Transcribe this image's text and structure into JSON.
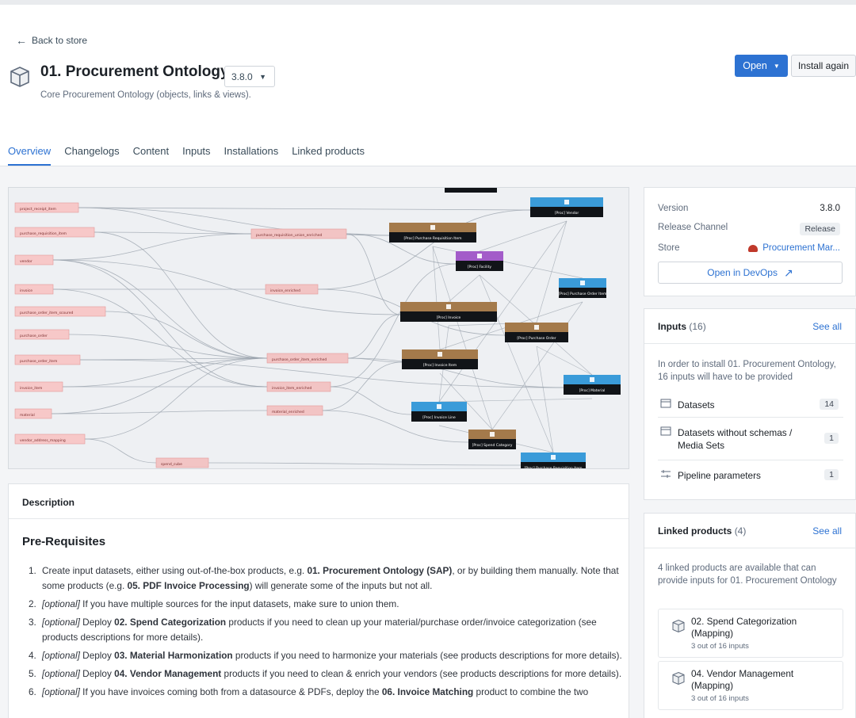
{
  "nav": {
    "back_label": "Back to store"
  },
  "product": {
    "title": "01. Procurement Ontology",
    "version": "3.8.0",
    "subtitle": "Core Procurement Ontology (objects, links & views)."
  },
  "actions": {
    "open_label": "Open",
    "install_label": "Install again"
  },
  "tabs": [
    {
      "label": "Overview",
      "active": true
    },
    {
      "label": "Changelogs"
    },
    {
      "label": "Content"
    },
    {
      "label": "Inputs"
    },
    {
      "label": "Installations"
    },
    {
      "label": "Linked products"
    }
  ],
  "sidebar": {
    "meta": {
      "version_label": "Version",
      "version_value": "3.8.0",
      "channel_label": "Release Channel",
      "channel_value": "Release",
      "store_label": "Store",
      "store_value": "Procurement Mar...",
      "devops_label": "Open in DevOps"
    },
    "inputs": {
      "title": "Inputs",
      "count": "(16)",
      "see_all": "See all",
      "note": "In order to install 01. Procurement Ontology, 16 inputs will have to be provided",
      "rows": [
        {
          "label": "Datasets",
          "count": "14",
          "icon": "table-icon"
        },
        {
          "label": "Datasets without schemas / Media Sets",
          "count": "1",
          "icon": "media-icon"
        },
        {
          "label": "Pipeline parameters",
          "count": "1",
          "icon": "parameter-icon"
        }
      ]
    },
    "linked": {
      "title": "Linked products",
      "count": "(4)",
      "see_all": "See all",
      "note": "4 linked products are available that can provide inputs for 01. Procurement Ontology",
      "items": [
        {
          "name": "02. Spend Categorization (Mapping)",
          "sub": "3 out of 16 inputs"
        },
        {
          "name": "04. Vendor Management (Mapping)",
          "sub": "3 out of 16 inputs"
        }
      ]
    }
  },
  "description": {
    "header": "Description",
    "heading": "Pre-Requisites",
    "steps": [
      {
        "num": "1.",
        "parts": [
          {
            "t": "Create input datasets, either using out-of-the-box products, e.g. "
          },
          {
            "t": "01. Procurement Ontology (SAP)",
            "b": true
          },
          {
            "t": ", or by building them manually. Note that some products (e.g. "
          },
          {
            "t": "05. PDF Invoice Processing",
            "b": true
          },
          {
            "t": ") will generate some of the inputs but not all."
          }
        ]
      },
      {
        "num": "2.",
        "parts": [
          {
            "t": "[optional]",
            "i": true
          },
          {
            "t": " If you have multiple sources for the input datasets, make sure to union them."
          }
        ]
      },
      {
        "num": "3.",
        "parts": [
          {
            "t": "[optional]",
            "i": true
          },
          {
            "t": " Deploy "
          },
          {
            "t": "02. Spend Categorization",
            "b": true
          },
          {
            "t": " products if you need to clean up your material/purchase order/invoice categorization (see products descriptions for more details)."
          }
        ]
      },
      {
        "num": "4.",
        "parts": [
          {
            "t": "[optional]",
            "i": true
          },
          {
            "t": " Deploy "
          },
          {
            "t": "03. Material Harmonization",
            "b": true
          },
          {
            "t": " products if you need to harmonize your materials (see products descriptions for more details)."
          }
        ]
      },
      {
        "num": "5.",
        "parts": [
          {
            "t": "[optional]",
            "i": true
          },
          {
            "t": " Deploy "
          },
          {
            "t": "04. Vendor Management",
            "b": true
          },
          {
            "t": " products if you need to clean & enrich your vendors (see products descriptions for more details)."
          }
        ]
      },
      {
        "num": "6.",
        "parts": [
          {
            "t": "[optional]",
            "i": true
          },
          {
            "t": " If you have invoices coming both from a datasource & PDFs, deploy the "
          },
          {
            "t": "06. Invoice Matching",
            "b": true
          },
          {
            "t": " product to combine the two"
          }
        ]
      }
    ]
  },
  "colors": {
    "accent": "#2d72d2",
    "input_node": "#f7c8c8",
    "transform_node": "#f2c4c4",
    "object_brown": "#a47a4b",
    "object_blue": "#3a9bd9",
    "object_purple": "#a35cc9",
    "object_dark": "#111418"
  },
  "graph": {
    "inputs": [
      "project_receipt_item",
      "purchase_requisition_item",
      "vendor",
      "invoice",
      "purchase_order_item_scoured",
      "purchase_order",
      "purchase_order_item",
      "invoice_item",
      "material",
      "vendor_address_mapping"
    ],
    "transforms": [
      "purchase_requisition_union_enriched",
      "invoice_enriched",
      "purchase_order_item_enriched",
      "invoice_item_enriched",
      "material_enriched",
      "spend_cube"
    ],
    "objects": [
      "[Proc] Purchase Requisition Item",
      "[Proc] Vendor",
      "[Proc] Facility",
      "[Proc] Purchase Order Item",
      "[Proc] Invoice",
      "[Proc] Purchase Order",
      "[Proc] Invoice Item",
      "[Proc] Material",
      "[Proc] Invoice Line",
      "[Proc] Spend Category"
    ]
  }
}
